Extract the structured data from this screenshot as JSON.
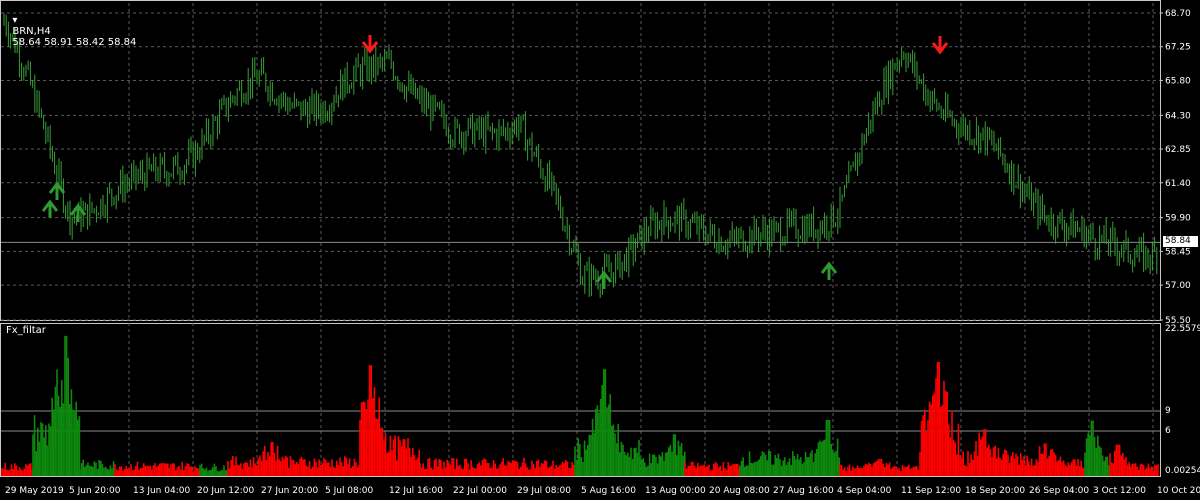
{
  "header": {
    "symbol": "BRN,H4",
    "ohlc": "58.64 58.91 58.42 58.84",
    "indicator_name": "Fx_filtar"
  },
  "colors": {
    "background": "#000000",
    "grid": "#5a5a5a",
    "candles": "#37a037",
    "signal_down": "#ff1a1a",
    "signal_up": "#2f9a2f",
    "hist_green": "#0d8a0d",
    "hist_red": "#ff0000"
  },
  "current_price": "58.84",
  "price_axis": [
    "68.70",
    "67.25",
    "65.80",
    "64.30",
    "62.85",
    "61.40",
    "59.90",
    "58.45",
    "57.00",
    "55.50"
  ],
  "indicator_axis": {
    "top": "22.5579",
    "level_high": "9",
    "level_low": "6",
    "bottom": "0.00254"
  },
  "time_axis": [
    "29 May 2019",
    "5 Jun 20:00",
    "13 Jun 04:00",
    "20 Jun 12:00",
    "27 Jun 20:00",
    "5 Jul 08:00",
    "12 Jul 16:00",
    "22 Jul 00:00",
    "29 Jul 08:00",
    "5 Aug 16:00",
    "13 Aug 00:00",
    "20 Aug 08:00",
    "27 Aug 16:00",
    "4 Sep 04:00",
    "11 Sep 12:00",
    "18 Sep 20:00",
    "26 Sep 04:00",
    "3 Oct 12:00",
    "10 Oct 20:00"
  ],
  "chart_data": {
    "type": "line",
    "title": "BRN,H4",
    "series": [
      {
        "name": "BRN,H4",
        "x": [
          "29 May",
          "5 Jun",
          "13 Jun",
          "20 Jun",
          "27 Jun",
          "5 Jul",
          "12 Jul",
          "22 Jul",
          "29 Jul",
          "5 Aug",
          "13 Aug",
          "20 Aug",
          "27 Aug",
          "4 Sep",
          "11 Sep",
          "18 Sep",
          "26 Sep",
          "3 Oct",
          "10 Oct"
        ],
        "values": [
          68.2,
          60.4,
          61.0,
          63.2,
          65.8,
          64.5,
          67.0,
          63.0,
          64.4,
          57.2,
          59.2,
          59.6,
          58.7,
          60.6,
          67.0,
          63.5,
          61.0,
          58.4,
          58.84
        ]
      }
    ],
    "signals": [
      {
        "type": "down",
        "x": "8 Jul",
        "price": 67.8
      },
      {
        "type": "down",
        "x": "14 Sep",
        "price": 67.4
      },
      {
        "type": "up",
        "x": "31 May",
        "price": 60.3
      },
      {
        "type": "up",
        "x": "2 Jun",
        "price": 59.8
      },
      {
        "type": "up",
        "x": "6 Aug",
        "price": 57.2
      },
      {
        "type": "up",
        "x": "3 Sep",
        "price": 57.7
      }
    ],
    "indicator": {
      "name": "Fx_filtar",
      "ylim": [
        0.00254,
        22.5579
      ],
      "levels": [
        6,
        9
      ],
      "peaks": [
        21.5,
        14.8,
        16.2,
        8.5,
        17.3,
        11.0,
        8.8,
        7.2,
        17.0,
        6.3,
        8.1
      ]
    }
  }
}
